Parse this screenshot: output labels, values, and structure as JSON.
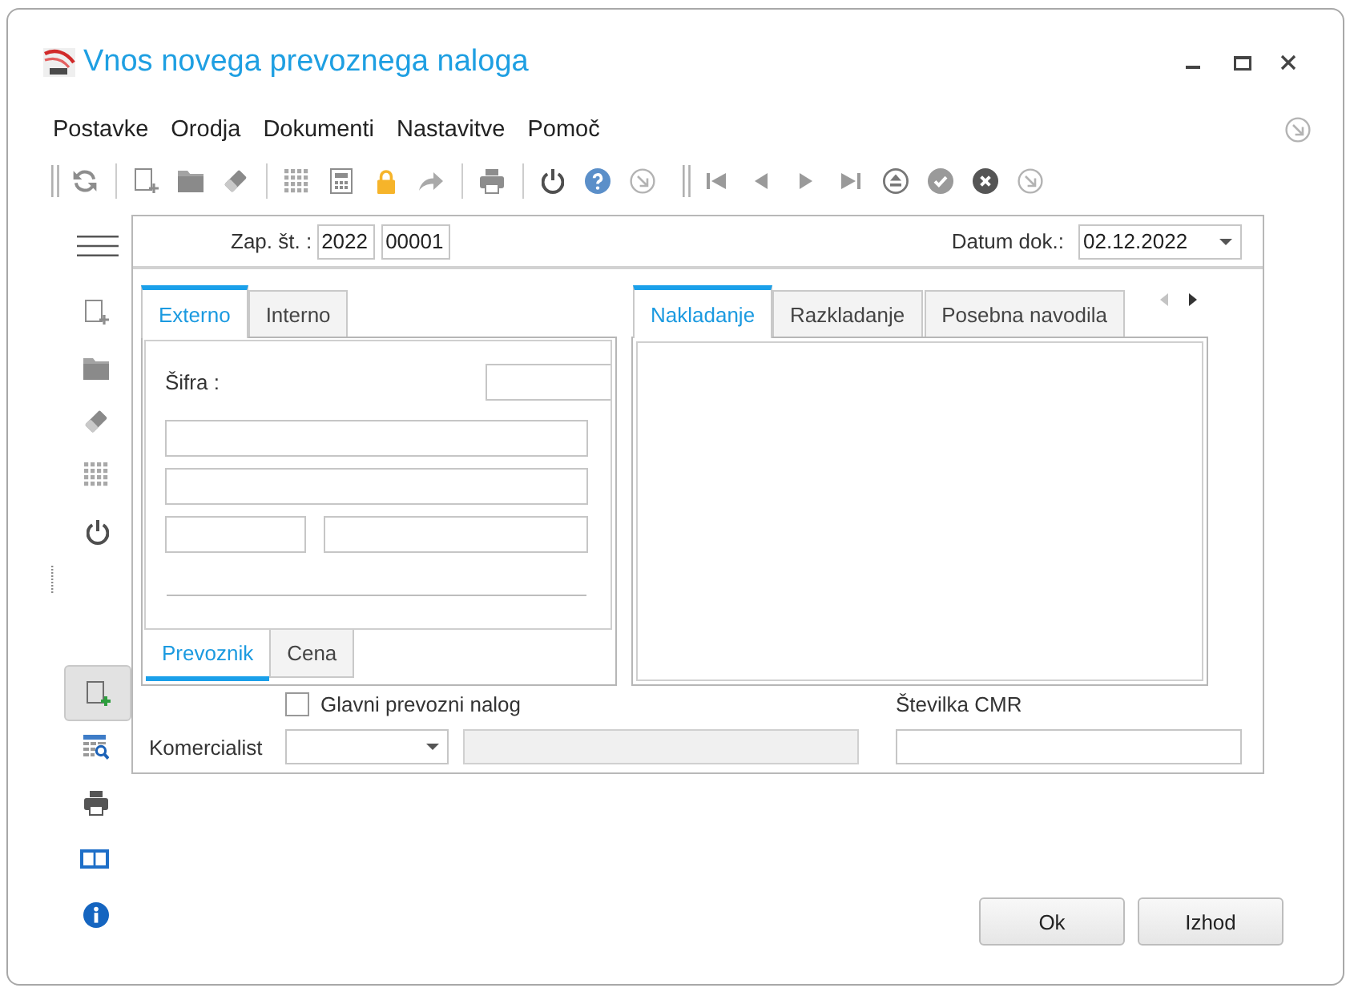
{
  "window": {
    "title": "Vnos novega prevoznega naloga"
  },
  "menu": [
    {
      "label": "Postavke"
    },
    {
      "label": "Orodja"
    },
    {
      "label": "Dokumenti"
    },
    {
      "label": "Nastavitve"
    },
    {
      "label": "Pomoč"
    }
  ],
  "header": {
    "number_label": "Zap. št. :",
    "year": "2022",
    "number": "00001",
    "date_label": "Datum dok.:",
    "date": "02.12.2022"
  },
  "left_tabs": [
    {
      "label": "Externo",
      "selected": true
    },
    {
      "label": "Interno",
      "selected": false
    }
  ],
  "carrier_form": {
    "code_label": "Šifra :"
  },
  "bottom_tabs": [
    {
      "label": "Prevoznik",
      "selected": true
    },
    {
      "label": "Cena",
      "selected": false
    }
  ],
  "right_tabs": [
    {
      "label": "Nakladanje",
      "selected": true
    },
    {
      "label": "Razkladanje",
      "selected": false
    },
    {
      "label": "Posebna navodila",
      "selected": false
    }
  ],
  "main_order": {
    "label": "Glavni prevozni nalog",
    "checked": false
  },
  "cmr": {
    "label": "Številka CMR"
  },
  "sales_rep": {
    "label": "Komercialist",
    "name_field": {
      "disabled": true
    }
  },
  "buttons": [
    {
      "label": "Ok"
    },
    {
      "label": "Izhod"
    }
  ]
}
